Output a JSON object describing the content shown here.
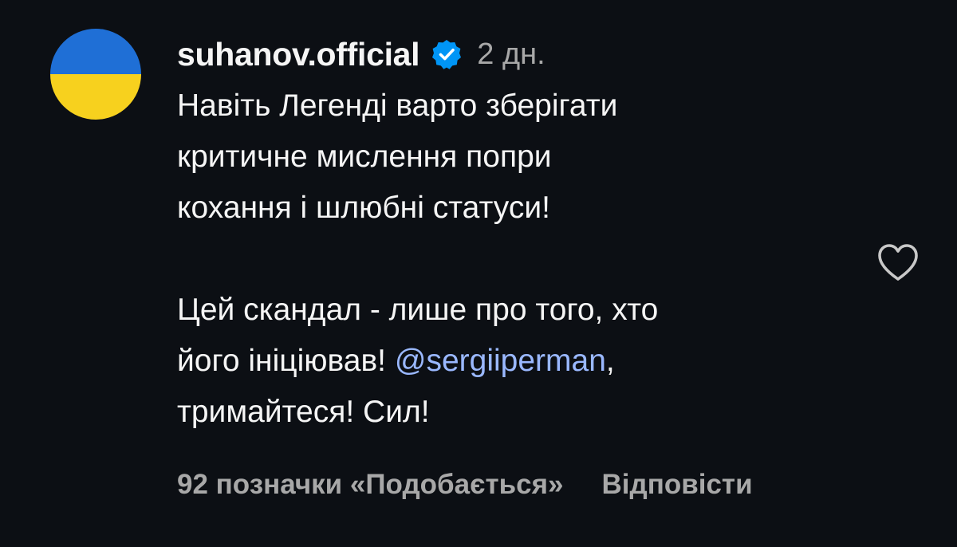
{
  "comment": {
    "username": "suhanov.official",
    "verified": true,
    "time": "2 дн.",
    "lines": [
      "Навіть Легенді варто зберігати",
      "критичне мислення попри",
      "кохання і шлюбні статуси!",
      "",
      "Цей скандал - лише про того, хто",
      "його ініціював! ",
      "тримайтеся! Сил!"
    ],
    "mention": "@sergiiperman",
    "mention_suffix": ",",
    "likes_label": "92 позначки «Подобається»",
    "reply_label": "Відповісти"
  },
  "colors": {
    "background": "#0c0f14",
    "text": "#f5f5f5",
    "secondary": "#a8a8a8",
    "mention": "#9ab8ff",
    "verified_badge": "#0095f6",
    "flag_blue": "#1f6fd6",
    "flag_yellow": "#f7d11e"
  },
  "icons": {
    "avatar": "ukraine-flag-avatar",
    "verified": "verified-badge-icon",
    "like": "heart-outline-icon"
  }
}
